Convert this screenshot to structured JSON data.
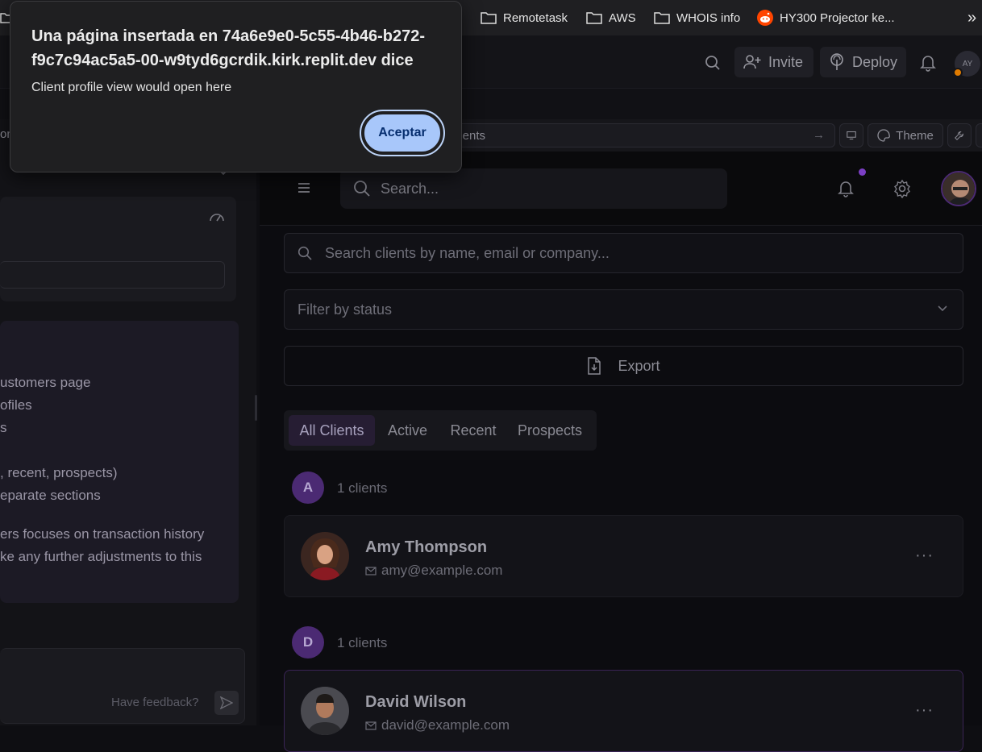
{
  "bookmarks": [
    {
      "label": "Remotetask",
      "icon": "folder-icon"
    },
    {
      "label": "AWS",
      "icon": "folder-icon"
    },
    {
      "label": "WHOIS info",
      "icon": "folder-icon"
    },
    {
      "label": "HY300 Projector ke...",
      "icon": "reddit-icon"
    }
  ],
  "bookmarks_overflow": "»",
  "topbar": {
    "invite_label": "Invite",
    "deploy_label": "Deploy",
    "avatar_initials": "AY"
  },
  "preview_bar": {
    "url_text": "lients",
    "left_fragment": "on",
    "theme_label": "Theme"
  },
  "agent_pane": {
    "lines": [
      "ustomers page",
      "ofiles",
      "s",
      ", recent, prospects)",
      "eparate sections",
      "ers focuses on transaction history",
      "ke any further adjustments to this"
    ],
    "feedback_placeholder": "Have feedback?"
  },
  "app": {
    "search_placeholder": "Search...",
    "client_search_placeholder": "Search clients by name, email or company...",
    "filter_placeholder": "Filter by status",
    "export_label": "Export",
    "tabs": [
      "All Clients",
      "Active",
      "Recent",
      "Prospects"
    ],
    "active_tab": "All Clients",
    "groups": [
      {
        "letter": "A",
        "count_text": "1 clients",
        "clients": [
          {
            "name": "Amy Thompson",
            "email": "amy@example.com"
          }
        ]
      },
      {
        "letter": "D",
        "count_text": "1 clients",
        "clients": [
          {
            "name": "David Wilson",
            "email": "david@example.com"
          }
        ]
      }
    ],
    "more_label": "···"
  },
  "dialog": {
    "title": "Una página insertada en 74a6e9e0-5c55-4b46-b272-f9c7c94ac5a5-00-w9tyd6gcrdik.kirk.replit.dev dice",
    "message": "Client profile view would open here",
    "button_label": "Aceptar"
  },
  "colors": {
    "accent": "#a8c7fa",
    "badge_purple": "#4b2a73",
    "notification_dot": "#7b3fc4"
  }
}
